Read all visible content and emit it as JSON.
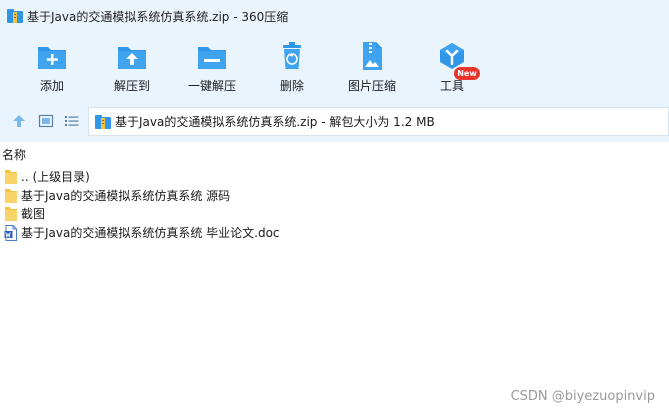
{
  "window": {
    "title": "基于Java的交通模拟系统仿真系统.zip - 360压缩"
  },
  "toolbar": {
    "items": [
      {
        "label": "添加",
        "icon": "add-folder-icon"
      },
      {
        "label": "解压到",
        "icon": "extract-to-icon"
      },
      {
        "label": "一键解压",
        "icon": "one-click-extract-icon"
      },
      {
        "label": "删除",
        "icon": "delete-icon"
      },
      {
        "label": "图片压缩",
        "icon": "image-compress-icon"
      },
      {
        "label": "工具",
        "icon": "tools-icon"
      }
    ],
    "badge": "New"
  },
  "addressbar": {
    "path": "基于Java的交通模拟系统仿真系统.zip - 解包大小为 1.2 MB"
  },
  "filelist": {
    "column_header": "名称",
    "rows": [
      {
        "name": ".. (上级目录)",
        "icon": "folder-icon"
      },
      {
        "name": "基于Java的交通模拟系统仿真系统 源码",
        "icon": "folder-icon"
      },
      {
        "name": "截图",
        "icon": "folder-icon"
      },
      {
        "name": "基于Java的交通模拟系统仿真系统 毕业论文.doc",
        "icon": "word-doc-icon"
      }
    ]
  },
  "watermark": "CSDN @biyezuopinvip",
  "colors": {
    "toolbar_bg": "#eaf4fd",
    "icon_blue": "#2f96e8",
    "folder_yellow": "#f5c542",
    "badge_red": "#e8342b"
  }
}
